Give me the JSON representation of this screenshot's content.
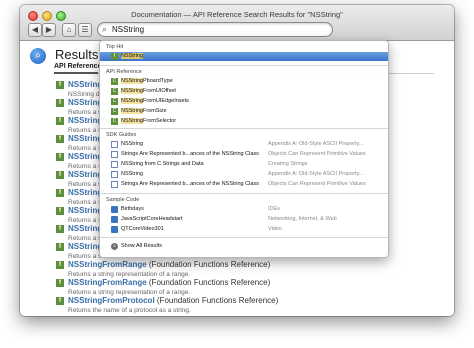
{
  "window": {
    "title": "Documentation — API Reference Search Results for \"NSString\"",
    "nav_back": "◀",
    "nav_forward": "▶",
    "nav_home": "⌂",
    "nav_bookmarks": "☰"
  },
  "search": {
    "value": "NSString",
    "icon": "search-icon"
  },
  "page": {
    "title": "Results",
    "tab_label": "API Reference"
  },
  "results": [
    {
      "name": "NSString",
      "ref": "",
      "desc": "NSString de"
    },
    {
      "name": "NSString",
      "ref": "",
      "desc": "Returns a s"
    },
    {
      "name": "NSString",
      "ref": "",
      "desc": "Returns a s"
    },
    {
      "name": "NSString",
      "ref": "",
      "desc": "Returns a s"
    },
    {
      "name": "NSString",
      "ref": "",
      "desc": "Returns a s"
    },
    {
      "name": "NSString",
      "ref": "",
      "desc": "Returns a s"
    },
    {
      "name": "NSString",
      "ref": "",
      "desc": "Returns a s"
    },
    {
      "name": "NSString",
      "ref": "",
      "desc": "Returns a s"
    },
    {
      "name": "NSString",
      "ref": "",
      "desc": "Returns a s"
    },
    {
      "name": "NSString",
      "ref": "",
      "desc": "Returns a s"
    },
    {
      "name": "NSStringFromRange",
      "ref": " (Foundation Functions Reference)",
      "desc": "Returns a string representation of a range."
    },
    {
      "name": "NSStringFromRange",
      "ref": " (Foundation Functions Reference)",
      "desc": "Returns a string representation of a range."
    },
    {
      "name": "NSStringFromProtocol",
      "ref": " (Foundation Functions Reference)",
      "desc": "Returns the name of a protocol as a string."
    }
  ],
  "dropdown": {
    "top_hit_header": "Top Hit",
    "top_hit": {
      "hl": "NSString",
      "rest": ""
    },
    "api_header": "API Reference",
    "api_items": [
      {
        "hl": "NSString",
        "rest": "PboardType"
      },
      {
        "hl": "NSString",
        "rest": "FromUIOffset"
      },
      {
        "hl": "NSString",
        "rest": "FromUIEdgeInsets"
      },
      {
        "hl": "NSString",
        "rest": "FromSize"
      },
      {
        "hl": "NSString",
        "rest": "FromSelector"
      }
    ],
    "guides_header": "SDK Guides",
    "guide_items": [
      {
        "label": "NSString",
        "cat": "Appendix A: Old-Style ASCII Property..."
      },
      {
        "label": "Strings Are Represented b...ances of the NSString Class",
        "cat": "Objects Can Represent Primitive Values"
      },
      {
        "label": "NSString from C Strings and Data",
        "cat": "Creating Strings"
      },
      {
        "label": "NSString",
        "cat": "Appendix A: Old-Style ASCII Property..."
      },
      {
        "label": "Strings Are Represented b...ances of the NSString Class",
        "cat": "Objects Can Represent Primitive Values"
      }
    ],
    "sample_header": "Sample Code",
    "sample_items": [
      {
        "label": "Birthdays",
        "cat": "IDEs"
      },
      {
        "label": "JavaScriptCoreHeadstart",
        "cat": "Networking, Internet, & Web"
      },
      {
        "label": "QTCoreVideo301",
        "cat": "Video"
      }
    ],
    "show_all": "Show All Results"
  },
  "colors": {
    "selection": "#3b74cc",
    "highlight": "#f4e3a0",
    "link": "#3a6ea8",
    "function_icon": "#5e8f3b"
  }
}
